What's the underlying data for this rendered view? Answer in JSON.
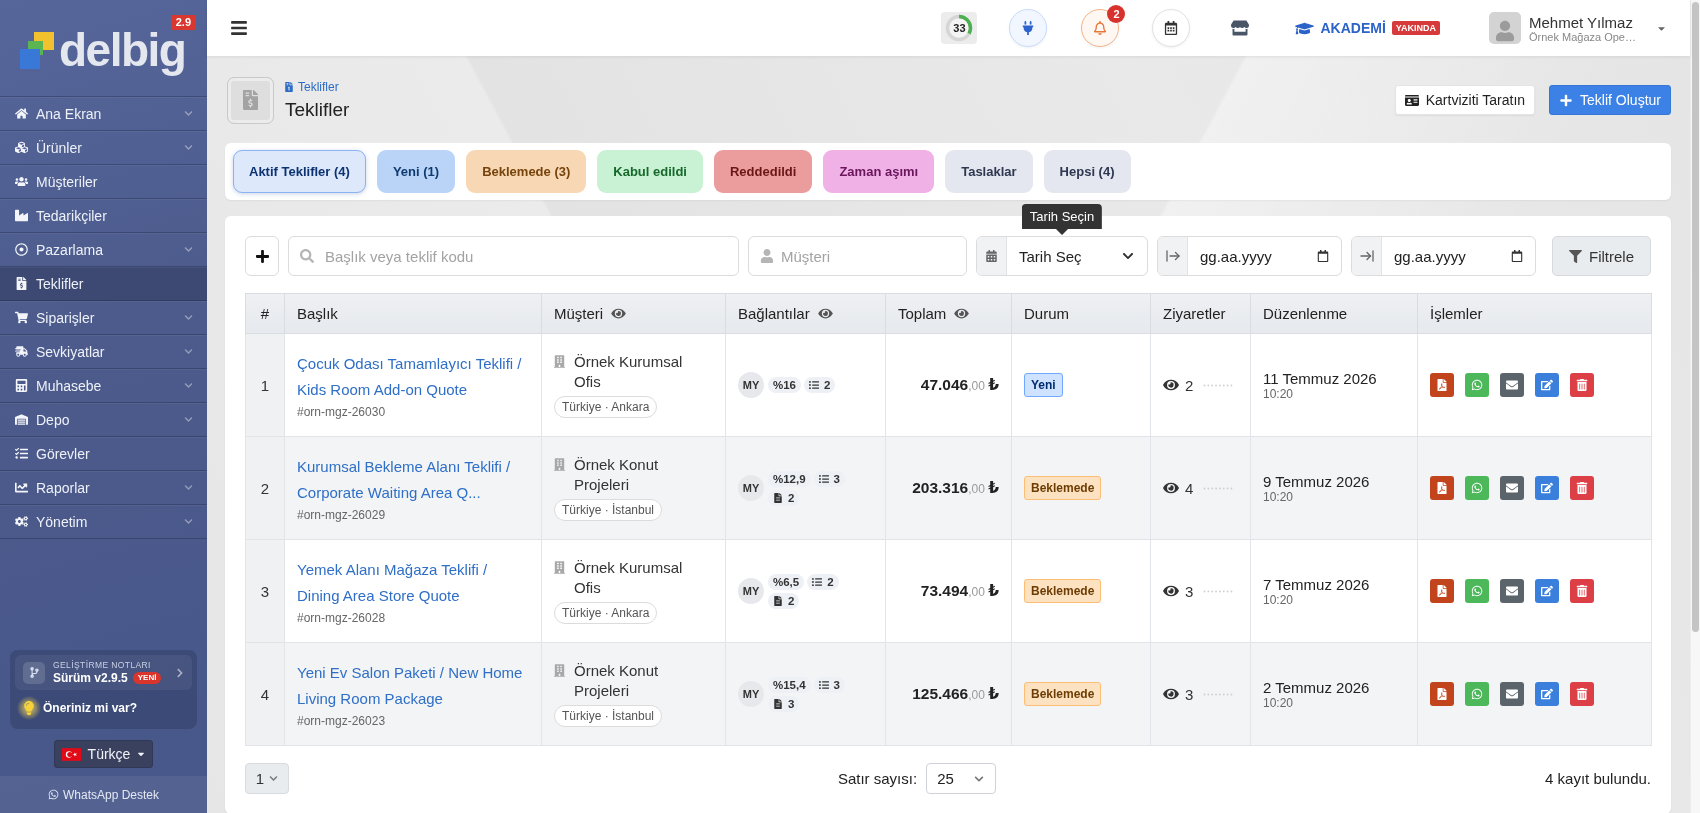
{
  "sidebar": {
    "logo": {
      "text": "delbig",
      "version": "2.9"
    },
    "items": [
      {
        "label": "Ana Ekran",
        "has_submenu": true,
        "selected": false
      },
      {
        "label": "Ürünler",
        "has_submenu": true,
        "selected": false
      },
      {
        "label": "Müşteriler",
        "has_submenu": false,
        "selected": false
      },
      {
        "label": "Tedarikçiler",
        "has_submenu": false,
        "selected": false
      },
      {
        "label": "Pazarlama",
        "has_submenu": true,
        "selected": false
      },
      {
        "label": "Teklifler",
        "has_submenu": false,
        "selected": true
      },
      {
        "label": "Siparişler",
        "has_submenu": true,
        "selected": false
      },
      {
        "label": "Sevkiyatlar",
        "has_submenu": true,
        "selected": false
      },
      {
        "label": "Muhasebe",
        "has_submenu": true,
        "selected": false
      },
      {
        "label": "Depo",
        "has_submenu": true,
        "selected": false
      },
      {
        "label": "Görevler",
        "has_submenu": false,
        "selected": false
      },
      {
        "label": "Raporlar",
        "has_submenu": true,
        "selected": false
      },
      {
        "label": "Yönetim",
        "has_submenu": true,
        "selected": false
      }
    ],
    "release_notes": {
      "title": "GELİŞTİRME NOTLARI",
      "version": "Sürüm v2.9.5",
      "badge": "YENİ"
    },
    "feedback": "Öneriniz mi var?",
    "language": "Türkçe",
    "support": "WhatsApp Destek"
  },
  "topbar": {
    "progress": {
      "label": "33",
      "level": 0.33
    },
    "notifications": {
      "count": "2"
    },
    "academy": {
      "label": "AKADEMİ",
      "badge": "YAKINDA"
    },
    "user": {
      "name": "Mehmet Yılmaz",
      "subtitle": "Örnek Mağaza Ope…"
    }
  },
  "page_header": {
    "breadcrumb": "Teklifler",
    "title": "Teklifler",
    "buttons": [
      {
        "label": "Kartviziti Taratın",
        "kind": "secondary"
      },
      {
        "label": "Teklif Oluştur",
        "kind": "primary"
      }
    ]
  },
  "status_tabs": [
    {
      "label": "Aktif Teklifler (4)",
      "selected": true,
      "color": "#dde8fb"
    },
    {
      "label": "Yeni (1)",
      "selected": false,
      "color": "#b9d4f6"
    },
    {
      "label": "Beklemede (3)",
      "selected": false,
      "color": "#f8d8b4"
    },
    {
      "label": "Kabul edildi",
      "selected": false,
      "color": "#c9f1d3"
    },
    {
      "label": "Reddedildi",
      "selected": false,
      "color": "#eb9c9c"
    },
    {
      "label": "Zaman aşımı",
      "selected": false,
      "color": "#efb1e6"
    },
    {
      "label": "Taslaklar",
      "selected": false,
      "color": "#e4e7ef"
    },
    {
      "label": "Hepsi (4)",
      "selected": false,
      "color": "#e4e7ef"
    }
  ],
  "filters": {
    "search": {
      "placeholder": "Başlık veya teklif kodu"
    },
    "customer": {
      "placeholder": "Müşteri"
    },
    "date_range": {
      "value": "Tarih Seç",
      "tooltip": "Tarih Seçin"
    },
    "date_from": {
      "placeholder": "gg.aa.yyyy"
    },
    "date_to": {
      "placeholder": "gg.aa.yyyy"
    },
    "filter_button": "Filtrele"
  },
  "table": {
    "columns": [
      {
        "label": "#",
        "visibility_toggle": false
      },
      {
        "label": "Başlık",
        "visibility_toggle": false
      },
      {
        "label": "Müşteri",
        "visibility_toggle": true
      },
      {
        "label": "Bağlantılar",
        "visibility_toggle": true
      },
      {
        "label": "Toplam",
        "visibility_toggle": true
      },
      {
        "label": "Durum",
        "visibility_toggle": false
      },
      {
        "label": "Ziyaretler",
        "visibility_toggle": false
      },
      {
        "label": "Düzenlenme",
        "visibility_toggle": false
      },
      {
        "label": "İşlemler",
        "visibility_toggle": false
      }
    ],
    "rows": [
      {
        "no": "1",
        "title": "Çocuk Odası Tamamlayıcı Teklifi / Kids Room Add-on Quote",
        "code": "#orn-mgz-26030",
        "customer": "Örnek Kurumsal Ofis",
        "location": "Türkiye · Ankara",
        "owner": "MY",
        "discount": "%16",
        "items": "2",
        "total": "**47.046**,00 **₺**",
        "status": {
          "label": "Yeni",
          "color": "#cfe2ff"
        },
        "visits": "2",
        "date": "11 Temmuz 2026",
        "time": "10:20"
      },
      {
        "no": "2",
        "title": "Kurumsal Bekleme Alanı Teklifi / Corporate Waiting Area Q...",
        "code": "#orn-mgz-26029",
        "customer": "Örnek Konut Projeleri",
        "location": "Türkiye · İstanbul",
        "owner": "MY",
        "discount": "%12,9",
        "items": "3",
        "attachments": "2",
        "total": "**203.316**,00 **₺**",
        "status": {
          "label": "Beklemede",
          "color": "#fde2c2"
        },
        "visits": "4",
        "date": "9 Temmuz 2026",
        "time": "10:20"
      },
      {
        "no": "3",
        "title": "Yemek Alanı Mağaza Teklifi / Dining Area Store Quote",
        "code": "#orn-mgz-26028",
        "customer": "Örnek Kurumsal Ofis",
        "location": "Türkiye · Ankara",
        "owner": "MY",
        "discount": "%6,5",
        "items": "2",
        "attachments": "2",
        "total": "**73.494**,00 **₺**",
        "status": {
          "label": "Beklemede",
          "color": "#fde2c2"
        },
        "visits": "3",
        "date": "7 Temmuz 2026",
        "time": "10:20"
      },
      {
        "no": "4",
        "title": "Yeni Ev Salon Paketi / New Home Living Room Package",
        "code": "#orn-mgz-26023",
        "customer": "Örnek Konut Projeleri",
        "location": "Türkiye · İstanbul",
        "owner": "MY",
        "discount": "%15,4",
        "items": "3",
        "attachments": "3",
        "total": "**125.466**,00 **₺**",
        "status": {
          "label": "Beklemede",
          "color": "#fde2c2"
        },
        "visits": "3",
        "date": "2 Temmuz 2026",
        "time": "10:20"
      }
    ]
  },
  "footer": {
    "page": "1",
    "rows_label": "Satır sayısı:",
    "rows_per_page": "25",
    "record_count": "4 kayıt bulundu."
  }
}
